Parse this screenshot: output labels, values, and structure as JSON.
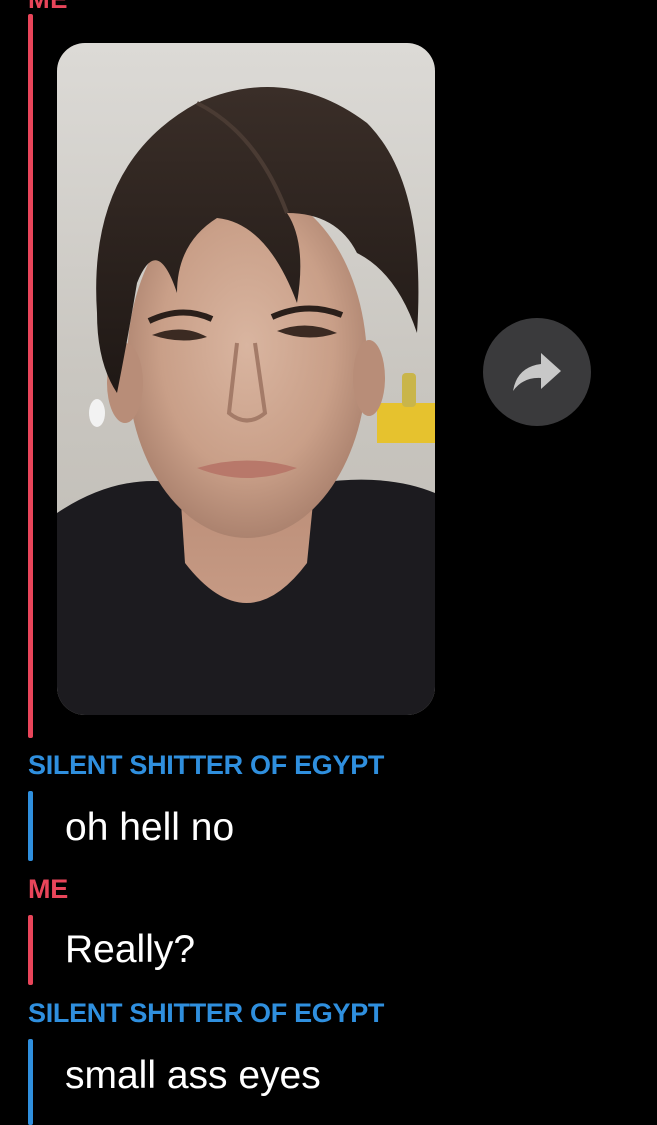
{
  "colors": {
    "me": "#e9455a",
    "friend": "#2f8fde",
    "background": "#000000",
    "share_button_bg": "#3a3a3c"
  },
  "top_label": "ME",
  "media": {
    "share_icon": "share-arrow-icon"
  },
  "messages": [
    {
      "sender": "SILENT SHITTER OF EGYPT",
      "text": "oh hell no"
    },
    {
      "sender": "ME",
      "text": "Really?"
    },
    {
      "sender": "SILENT SHITTER OF EGYPT",
      "text": "small ass eyes"
    }
  ]
}
